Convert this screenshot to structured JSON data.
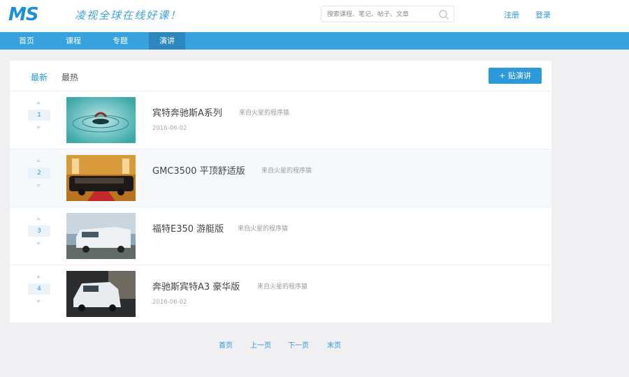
{
  "header": {
    "logo": "MS",
    "slogan": "凌视全球在线好课！",
    "search_placeholder": "搜索课程、笔记、帖子、文章",
    "register": "注册",
    "login": "登录"
  },
  "nav": [
    "首页",
    "课程",
    "专题",
    "演讲"
  ],
  "tabs": {
    "latest": "最新",
    "hot": "最热"
  },
  "post_button": "+ 贴演讲",
  "posts": [
    {
      "rank": "1",
      "title": "宾特奔驰斯A系列",
      "author": "来自火星的程序猿",
      "date": "2016-06-02"
    },
    {
      "rank": "2",
      "title": "GMC3500 平顶舒适版",
      "author": "来自火星的程序猿",
      "date": ""
    },
    {
      "rank": "3",
      "title": "福特E350 游艇版",
      "author": "来自火星的程序猿",
      "date": ""
    },
    {
      "rank": "4",
      "title": "奔驰斯宾特A3 豪华版",
      "author": "来自火星的程序猿",
      "date": "2016-06-02"
    }
  ],
  "pagination": {
    "first": "首页",
    "prev": "上一页",
    "next": "下一页",
    "last": "末页"
  },
  "colors": {
    "brand": "#37a2dd",
    "nav_active": "#2b87bd",
    "link": "#2a97d6"
  }
}
